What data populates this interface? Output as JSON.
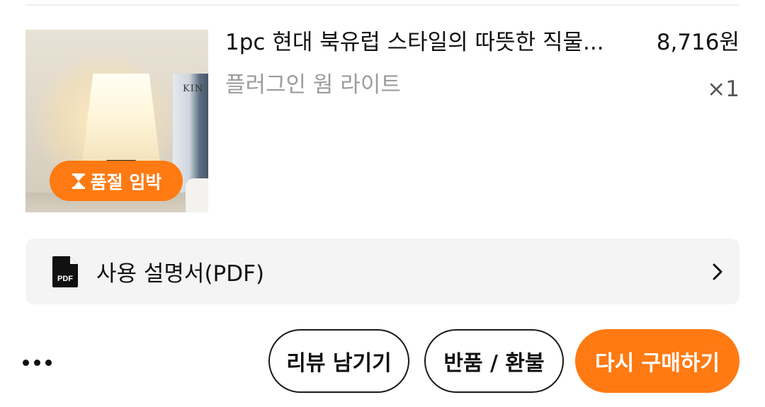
{
  "order_item": {
    "title": "1pc 현대 북유럽 스타일의 따뜻한 직물...",
    "price": "8,716원",
    "option": "플러그인 웜 라이트",
    "quantity": "×1",
    "badge": {
      "label": "품절 임박",
      "icon": "hourglass-icon",
      "color": "#ff7a12"
    },
    "thumbnail": {
      "icon": "lamp-product-image",
      "book_text": "KIN"
    }
  },
  "manual": {
    "icon": "pdf-file-icon",
    "label": "사용 설명서(PDF)",
    "chevron": "chevron-right-icon"
  },
  "actions": {
    "more_icon": "more-dots-icon",
    "review_label": "리뷰 남기기",
    "return_label": "반품 / 환불",
    "rebuy_label": "다시 구매하기",
    "accent_color": "#ff7a12"
  }
}
